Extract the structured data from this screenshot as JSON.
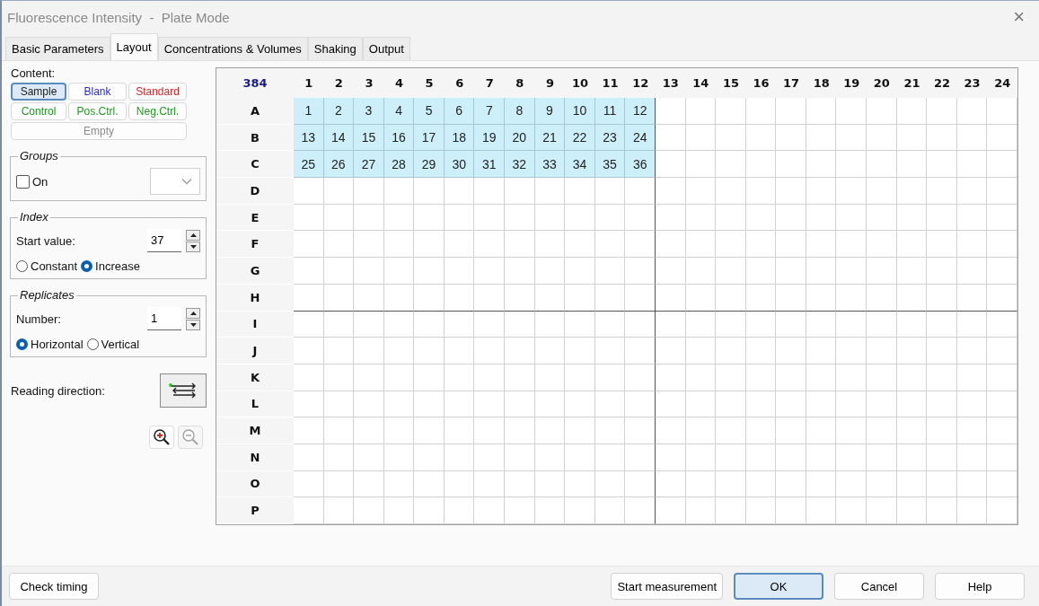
{
  "window": {
    "title": "Fluorescence Intensity  -  Plate Mode",
    "close": "×"
  },
  "tabs": [
    {
      "label": "Basic Parameters",
      "selected": false
    },
    {
      "label": "Layout",
      "selected": true
    },
    {
      "label": "Concentrations & Volumes",
      "selected": false
    },
    {
      "label": "Shaking",
      "selected": false
    },
    {
      "label": "Output",
      "selected": false
    }
  ],
  "content": {
    "label": "Content:",
    "buttons": [
      {
        "label": "Sample",
        "color": "#1a1a1a",
        "selected": true,
        "kind": "type"
      },
      {
        "label": "Blank",
        "color": "#2a2ad0",
        "selected": false,
        "kind": "type"
      },
      {
        "label": "Standard",
        "color": "#e02020",
        "selected": false,
        "kind": "type"
      },
      {
        "label": "Control",
        "color": "#1f9a1f",
        "selected": false,
        "kind": "type"
      },
      {
        "label": "Pos.Ctrl.",
        "color": "#1f9a1f",
        "selected": false,
        "kind": "type"
      },
      {
        "label": "Neg.Ctrl.",
        "color": "#1f9a1f",
        "selected": false,
        "kind": "type"
      },
      {
        "label": "Empty",
        "color": "#8a8a8a",
        "selected": false,
        "kind": "empty"
      }
    ]
  },
  "groups": {
    "title": "Groups",
    "checkbox": {
      "label": "On",
      "checked": false
    }
  },
  "index": {
    "title": "Index",
    "start_label": "Start value:",
    "start_value": "37",
    "modes": [
      {
        "label": "Constant",
        "selected": false
      },
      {
        "label": "Increase",
        "selected": true
      }
    ]
  },
  "replicates": {
    "title": "Replicates",
    "number_label": "Number:",
    "number_value": "1",
    "directions": [
      {
        "label": "Horizontal",
        "selected": true
      },
      {
        "label": "Vertical",
        "selected": false
      }
    ]
  },
  "reading_direction": {
    "label": "Reading direction:"
  },
  "zoom": {
    "zoom_out_disabled": true
  },
  "plate": {
    "corner": "384",
    "columns": [
      "1",
      "2",
      "3",
      "4",
      "5",
      "6",
      "7",
      "8",
      "9",
      "10",
      "11",
      "12",
      "13",
      "14",
      "15",
      "16",
      "17",
      "18",
      "19",
      "20",
      "21",
      "22",
      "23",
      "24"
    ],
    "rows": [
      {
        "label": "A",
        "wells": [
          "1",
          "2",
          "3",
          "4",
          "5",
          "6",
          "7",
          "8",
          "9",
          "10",
          "11",
          "12"
        ]
      },
      {
        "label": "B",
        "wells": [
          "13",
          "14",
          "15",
          "16",
          "17",
          "18",
          "19",
          "20",
          "21",
          "22",
          "23",
          "24"
        ]
      },
      {
        "label": "C",
        "wells": [
          "25",
          "26",
          "27",
          "28",
          "29",
          "30",
          "31",
          "32",
          "33",
          "34",
          "35",
          "36"
        ]
      },
      {
        "label": "D"
      },
      {
        "label": "E"
      },
      {
        "label": "F"
      },
      {
        "label": "G"
      },
      {
        "label": "H"
      },
      {
        "label": "I"
      },
      {
        "label": "J"
      },
      {
        "label": "K"
      },
      {
        "label": "L"
      },
      {
        "label": "M"
      },
      {
        "label": "N"
      },
      {
        "label": "O"
      },
      {
        "label": "P"
      }
    ]
  },
  "footer": {
    "left": "Check timing",
    "buttons": [
      {
        "label": "Start measurement",
        "selected": false
      },
      {
        "label": "OK",
        "selected": true
      },
      {
        "label": "Cancel",
        "selected": false
      },
      {
        "label": "Help",
        "selected": false
      }
    ]
  }
}
